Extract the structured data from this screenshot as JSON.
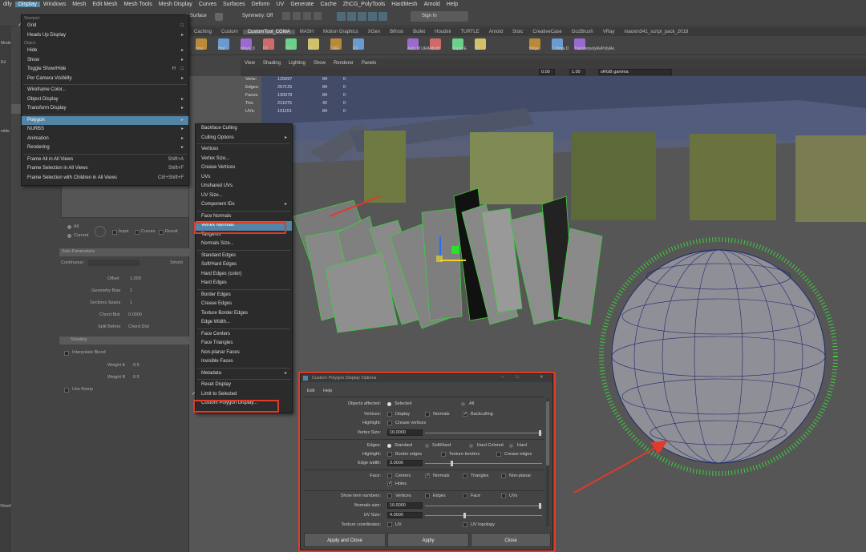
{
  "menubar": {
    "items": [
      "dify",
      "Display",
      "Windows",
      "Mesh",
      "Edit Mesh",
      "Mesh Tools",
      "Mesh Display",
      "Curves",
      "Surfaces",
      "Deform",
      "UV",
      "Generate",
      "Cache",
      "ZhCG_PolyTools",
      "HardMesh",
      "Arnold",
      "Help"
    ],
    "active": "Display"
  },
  "status_bar": {
    "surface_label": "e Surface",
    "symmetry": "Symmetry: Off",
    "sign_in": "Sign In"
  },
  "shelf": {
    "tabs": [
      "Caching",
      "Custom",
      "CustomTool_CGMA",
      "MASH",
      "Motion Graphics",
      "XGen",
      "Bifrost",
      "Bullet",
      "Houdini",
      "TURTLE",
      "Arnold",
      "Stoic",
      "CreativeCase",
      "Go2Brush",
      "VRay",
      "maoxin341_script_pack_2018"
    ],
    "active_tab": "CustomTool_CGMA",
    "buttons": [
      "Inse",
      "Hist",
      "Maya_8",
      "FT",
      "CP",
      "RT",
      "CRE",
      "ES",
      "Auto M URA ma",
      "Modif",
      "Super E",
      "UV",
      "Ninja",
      "C Ninja D",
      "TransferpolyRePolyRe"
    ]
  },
  "left_labels": [
    "Mode",
    "Ed",
    "mble",
    "VilewSelectedSetp"
  ],
  "display_menu": {
    "header": "Viewport",
    "items": [
      {
        "label": "Grid",
        "check": true,
        "box": true
      },
      {
        "label": "Heads Up Display",
        "arrow": true
      },
      {
        "hdr": "Object"
      },
      {
        "label": "Hide",
        "arrow": true
      },
      {
        "label": "Show",
        "arrow": true
      },
      {
        "label": "Toggle Show/Hide",
        "shortcut": "H",
        "box": true
      },
      {
        "label": "Per Camera Visibility",
        "arrow": true
      },
      {
        "sep": true
      },
      {
        "label": "Wireframe Color..."
      },
      {
        "label": "Object Display",
        "arrow": true
      },
      {
        "label": "Transform Display",
        "arrow": true
      },
      {
        "sep": true
      },
      {
        "label": "Polygon",
        "arrow": true,
        "hl": true
      },
      {
        "label": "NURBS",
        "arrow": true
      },
      {
        "label": "Animation",
        "arrow": true
      },
      {
        "label": "Rendering",
        "arrow": true
      },
      {
        "sep": true
      },
      {
        "label": "Frame All in All Views",
        "shortcut": "Shift+A"
      },
      {
        "label": "Frame Selection in All Views",
        "shortcut": "Shift+F"
      },
      {
        "label": "Frame Selection with Children in All Views",
        "shortcut": "Ctrl+Shift+F"
      }
    ]
  },
  "polygon_menu": {
    "items": [
      {
        "label": "Backface Culling"
      },
      {
        "label": "Culling Options",
        "arrow": true
      },
      {
        "sep": true
      },
      {
        "label": "Vertices"
      },
      {
        "label": "Vertex Size..."
      },
      {
        "label": "Crease Vertices"
      },
      {
        "label": "UVs"
      },
      {
        "label": "Unshared UVs"
      },
      {
        "label": "UV Size..."
      },
      {
        "label": "Component IDs",
        "arrow": true
      },
      {
        "sep": true
      },
      {
        "label": "Face Normals"
      },
      {
        "label": "Vertex Normals",
        "hl": true
      },
      {
        "label": "Tangents"
      },
      {
        "label": "Normals Size..."
      },
      {
        "sep": true
      },
      {
        "label": "Standard Edges"
      },
      {
        "label": "Soft/Hard Edges"
      },
      {
        "label": "Hard Edges (color)"
      },
      {
        "label": "Hard Edges"
      },
      {
        "sep": true
      },
      {
        "label": "Border Edges"
      },
      {
        "label": "Crease Edges"
      },
      {
        "label": "Texture Border Edges"
      },
      {
        "label": "Edge Width..."
      },
      {
        "sep": true
      },
      {
        "label": "Face Centers"
      },
      {
        "label": "Face Triangles"
      },
      {
        "label": "Non-planar Faces"
      },
      {
        "label": "Invisible Faces"
      },
      {
        "sep": true
      },
      {
        "label": "Metadata",
        "arrow": true
      },
      {
        "sep": true
      },
      {
        "label": "Reset Display"
      },
      {
        "label": "Limit to Selected",
        "check": true
      },
      {
        "label": "Custom Polygon Display..."
      }
    ]
  },
  "attribute_editor": {
    "radio_all": "All",
    "radio_current": "Current",
    "opts": [
      "Input",
      "Curves",
      "Result"
    ],
    "section_smooth": "Sets Parameters",
    "continuity": "Continuous",
    "smooth_lbl": "Smoot",
    "offset_lbl": "Offset",
    "offset_val": "1.000",
    "geom_bias_lbl": "Geometry Bias",
    "geom_bias_val": "1",
    "sections_lbl": "Sections Spans",
    "sections_val": "1",
    "chord_lbl": "Chord Bist",
    "chord_val": "0.0000",
    "split_lbl": "Split Before",
    "split_val": "Chord Dist",
    "section_shading": "Shading",
    "interp": "Interpolate Blend",
    "weight_a": "Weight A",
    "weight_a_val": "0.5",
    "weight_b": "Weight B",
    "weight_b_val": "0.5",
    "use_ramp": "Use Ramp"
  },
  "panel_menu": [
    "View",
    "Shading",
    "Lighting",
    "Show",
    "Renderer",
    "Panels"
  ],
  "panel_fields": {
    "exposure": "0.00",
    "gamma": "1.00",
    "color_space": "sRGB gamma"
  },
  "hud": {
    "rows": [
      [
        "Verts:",
        "125097",
        "84",
        "0"
      ],
      [
        "Edges:",
        "267125",
        "84",
        "0"
      ],
      [
        "Faces:",
        "130078",
        "84",
        "0"
      ],
      [
        "Tris:",
        "211075",
        "42",
        "0"
      ],
      [
        "UVs:",
        "101151",
        "84",
        "0"
      ]
    ]
  },
  "dialog": {
    "title": "Custom Polygon Display Options",
    "menu": [
      "Edit",
      "Help"
    ],
    "objects_affected_lbl": "Objects affected:",
    "selected": "Selected",
    "all": "All",
    "vertices_lbl": "Vertices:",
    "display": "Display",
    "normals": "Normals",
    "backculling": "Backculling",
    "highlight_lbl": "Highlight:",
    "crease_vertices": "Crease vertices",
    "vertex_size_lbl": "Vertex Size:",
    "vertex_size": "10.0000",
    "edges_lbl": "Edges:",
    "standard": "Standard",
    "soft_hard": "Soft/Hard",
    "hard_colored": "Hard Colored",
    "hard": "Hard",
    "highlight2_lbl": "Highlight:",
    "border_edges": "Border edges",
    "texture_borders": "Texture borders",
    "crease_edges": "Crease edges",
    "edge_width_lbl": "Edge width:",
    "edge_width": "3.0000",
    "face_lbl": "Face:",
    "centers": "Centers",
    "face_normals": "Normals",
    "triangles": "Triangles",
    "non_planar": "Non-planar",
    "holes": "Holes",
    "show_item_lbl": "Show item numbers:",
    "vertices_opt": "Vertices",
    "edges_opt": "Edges",
    "face_opt": "Face",
    "uvs_opt": "UVs",
    "normals_size_lbl": "Normals size:",
    "normals_size": "10.0000",
    "uv_size_lbl": "UV Size:",
    "uv_size": "4.0000",
    "tex_coord_lbl": "Texture coordinates:",
    "uv": "UV",
    "uv_topology": "UV topology",
    "apply_close": "Apply and Close",
    "apply": "Apply",
    "close": "Close"
  },
  "colors": {
    "accent": "#5285a6",
    "highlight_box": "#e03a2a",
    "normals": "#39d23a"
  }
}
